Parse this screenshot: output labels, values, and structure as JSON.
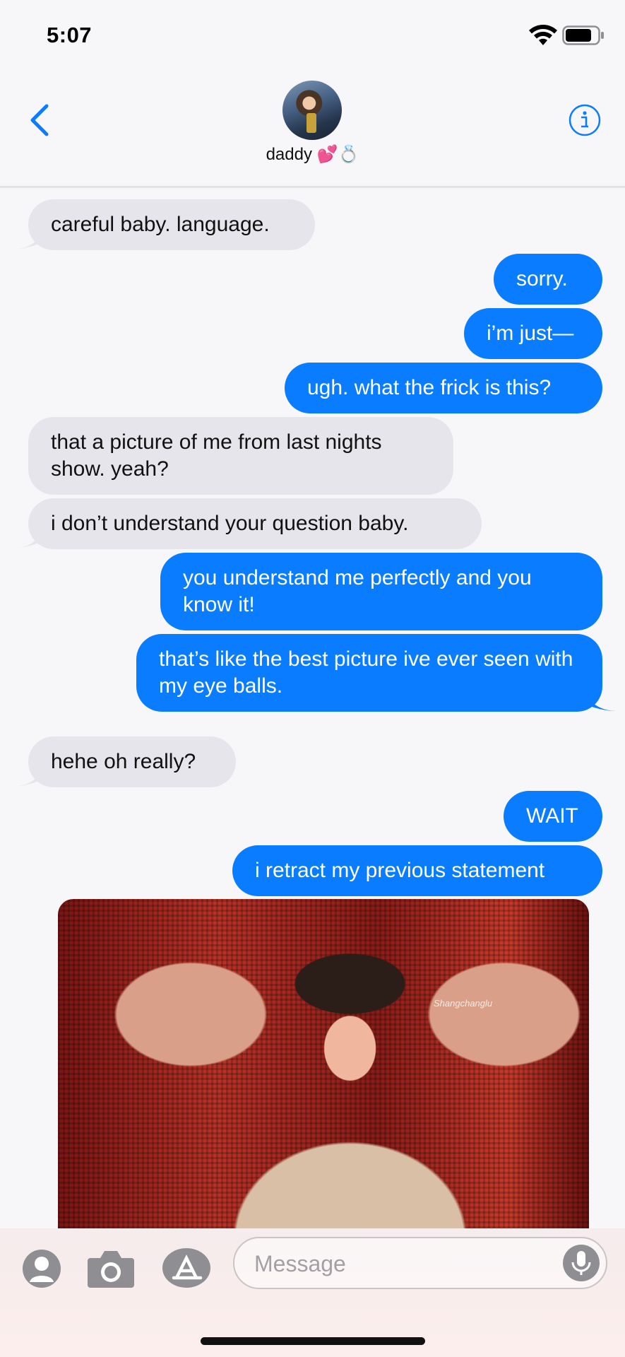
{
  "status_bar": {
    "time": "5:07"
  },
  "header": {
    "contact_name": "daddy 💕💍"
  },
  "messages": [
    {
      "from": "them",
      "text": "careful baby. language."
    },
    {
      "from": "me",
      "text": "sorry."
    },
    {
      "from": "me",
      "text": "i’m just—"
    },
    {
      "from": "me",
      "text": "ugh. what the frick is this?"
    },
    {
      "from": "them",
      "text": "that a picture of me from last nights show. yeah?"
    },
    {
      "from": "them",
      "text": "i don’t understand your question baby."
    },
    {
      "from": "me",
      "text": "you understand me perfectly and you know it!"
    },
    {
      "from": "me",
      "text": "that’s like the best picture ive ever seen with my eye balls."
    },
    {
      "from": "them",
      "text": "hehe oh really?"
    },
    {
      "from": "me",
      "text": "WAIT"
    },
    {
      "from": "me",
      "text": "i retract my previous statement"
    }
  ],
  "photo": {
    "signature": "Shangchanglu"
  },
  "composer": {
    "placeholder": "Message"
  },
  "colors": {
    "accent": "#0a7cff",
    "incoming_bubble": "#e6e5eb",
    "outgoing_bubble": "#0a7cff"
  },
  "icons": [
    "back-chevron-icon",
    "info-icon",
    "contacts-icon",
    "camera-icon",
    "app-store-icon",
    "microphone-icon",
    "wifi-icon",
    "battery-icon"
  ]
}
